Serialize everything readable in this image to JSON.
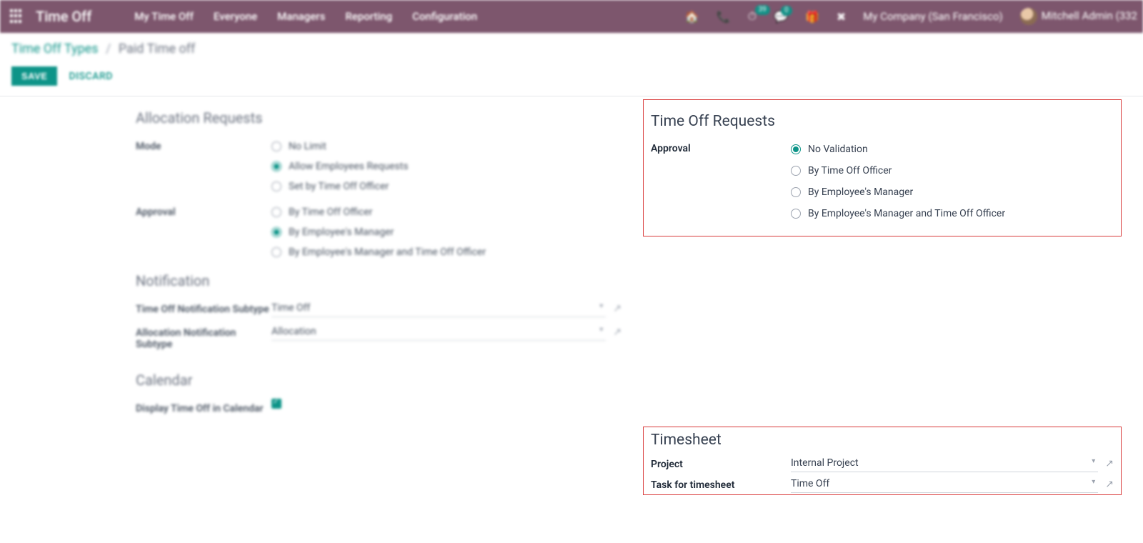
{
  "topnav": {
    "app_title": "Time Off",
    "menu": [
      "My Time Off",
      "Everyone",
      "Managers",
      "Reporting",
      "Configuration"
    ],
    "badge1": "39",
    "badge2": "0",
    "company": "My Company (San Francisco)",
    "user": "Mitchell Admin (332"
  },
  "breadcrumb": {
    "parent": "Time Off Types",
    "current": "Paid Time off"
  },
  "actions": {
    "save": "SAVE",
    "discard": "DISCARD"
  },
  "left": {
    "alloc": {
      "title": "Allocation Requests",
      "mode_label": "Mode",
      "mode_opts": [
        "No Limit",
        "Allow Employees Requests",
        "Set by Time Off Officer"
      ],
      "approval_label": "Approval",
      "approval_opts": [
        "By Time Off Officer",
        "By Employee's Manager",
        "By Employee's Manager and Time Off Officer"
      ]
    },
    "notif": {
      "title": "Notification",
      "sub1_label": "Time Off Notification Subtype",
      "sub1_value": "Time Off",
      "sub2_label": "Allocation Notification Subtype",
      "sub2_value": "Allocation"
    },
    "cal": {
      "title": "Calendar",
      "display_label": "Display Time Off in Calendar"
    }
  },
  "right": {
    "requests": {
      "title": "Time Off Requests",
      "approval_label": "Approval",
      "opts": [
        "No Validation",
        "By Time Off Officer",
        "By Employee's Manager",
        "By Employee's Manager and Time Off Officer"
      ]
    },
    "timesheet": {
      "title": "Timesheet",
      "project_label": "Project",
      "project_value": "Internal Project",
      "task_label": "Task for timesheet",
      "task_value": "Time Off"
    }
  }
}
